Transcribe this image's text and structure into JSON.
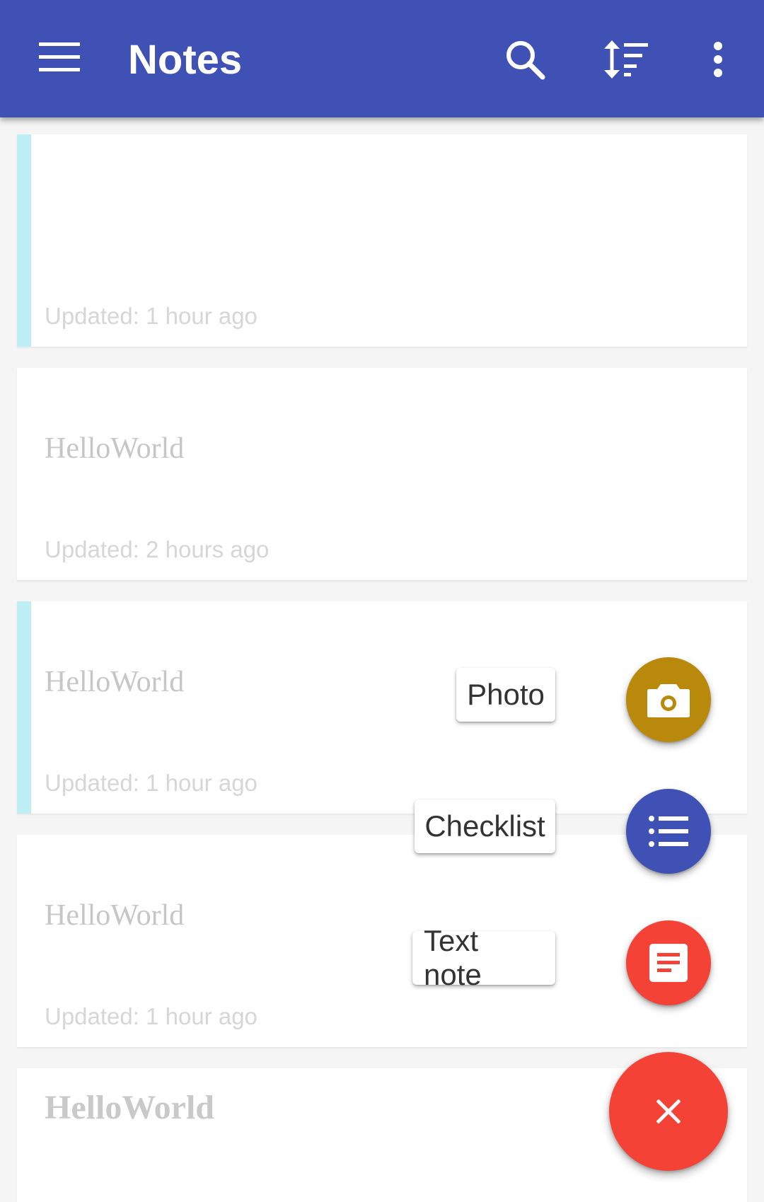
{
  "app_bar": {
    "title": "Notes",
    "background_color": "#3f51b5",
    "icons": [
      "menu-icon",
      "search-icon",
      "sort-icon",
      "more-vert-icon"
    ]
  },
  "notes": [
    {
      "title": "",
      "updated": "Updated: 1 hour ago",
      "has_color_tag": true,
      "tag_color": "#bdeff4"
    },
    {
      "title": "HelloWorld",
      "updated": "Updated: 2 hours ago",
      "has_color_tag": false
    },
    {
      "title": "HelloWorld",
      "updated": "Updated: 1 hour ago",
      "has_color_tag": true,
      "tag_color": "#bdeff4"
    },
    {
      "title": "HelloWorld",
      "updated": "Updated: 1 hour ago",
      "has_color_tag": false
    },
    {
      "title": "HelloWorld",
      "updated": "",
      "has_color_tag": false
    }
  ],
  "fab_menu": {
    "items": [
      {
        "label": "Photo",
        "icon": "camera-icon",
        "color": "#b8890b"
      },
      {
        "label": "Checklist",
        "icon": "list-icon",
        "color": "#3f51b5"
      },
      {
        "label": "Text note",
        "icon": "note-icon",
        "color": "#f44336"
      }
    ],
    "main_button": {
      "icon": "close-icon",
      "color": "#f44336"
    }
  }
}
